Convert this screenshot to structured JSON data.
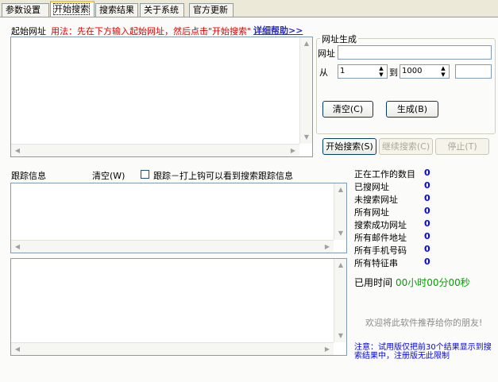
{
  "tabs": [
    {
      "label": "参数设置"
    },
    {
      "label": "开始搜索"
    },
    {
      "label": "搜索结果"
    },
    {
      "label": "关于系统"
    },
    {
      "label": "官方更新"
    }
  ],
  "start_url": {
    "label": "起始网址",
    "usage": "用法：先在下方输入起始网址，然后点击\"开始搜索\"",
    "help_link": "详细帮助>>"
  },
  "url_gen": {
    "group_label": "网址生成",
    "url_label": "网址",
    "url_value": "",
    "from_label": "从",
    "from_value": "1",
    "to_label": "到",
    "to_value": "1000",
    "extra_value": "",
    "clear_button": "清空(C)",
    "generate_button": "生成(B)"
  },
  "actions": {
    "start_search": "开始搜索(S)",
    "continue_search": "继续搜索(C)",
    "stop": "停止(T)"
  },
  "trace": {
    "label": "跟踪信息",
    "clear_label": "清空(W)",
    "checkbox_label": "跟踪－打上钩可以看到搜索跟踪信息"
  },
  "stats": [
    {
      "label": "正在工作的数目",
      "value": "0"
    },
    {
      "label": "已搜网址",
      "value": "0"
    },
    {
      "label": "未搜索网址",
      "value": "0"
    },
    {
      "label": "所有网址",
      "value": "0"
    },
    {
      "label": "搜索成功网址",
      "value": "0"
    },
    {
      "label": "所有邮件地址",
      "value": "0"
    },
    {
      "label": "所有手机号码",
      "value": "0"
    },
    {
      "label": "所有特征串",
      "value": "0"
    }
  ],
  "elapsed": {
    "label": "已用时间",
    "value": "00小时00分00秒"
  },
  "recommend": "欢迎将此软件推荐给你的朋友!",
  "notice": "注意：试用版仅把前30个结果显示到搜索结果中，注册版无此限制",
  "colors": {
    "panel_bg": "#fbfbf9",
    "dialog_bg": "#ece9d8",
    "accent_blue": "#0000ff",
    "red": "#e00000",
    "green": "#00a000"
  }
}
